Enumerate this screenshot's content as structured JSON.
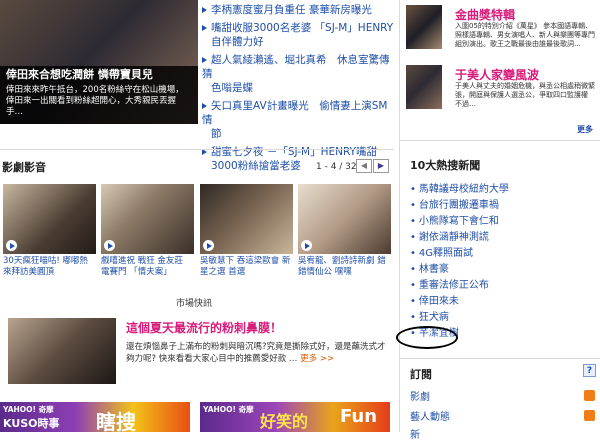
{
  "feature": {
    "title": "倖田來合想吃潤餅 憐帶寶貝兒",
    "desc": "倖田來來昨午抵台，200名粉絲守在松山機場，倖田來一出關看到粉絲超開心，大秀親民丟握手…"
  },
  "news": [
    "李柄憲度蜜月負重任 豪華新房曝光",
    "嘴甜收服3000名老婆 「SJ-M」HENRY",
    "自伴體力好",
    "超人氣綾瀨遙、堀北真希　休息室驚傳猜",
    "色嗡是蝶",
    "矢口真里AV計畫曝光　偷情妻上演SM情",
    "節",
    "甜蜜七夕夜 －「SJ-M」HENRY嘴甜",
    "3000粉絲搶當老婆"
  ],
  "media": {
    "title": "影劇影音",
    "pager": "1 - 4 / 32",
    "prev": "◀",
    "next": "▶",
    "videos": [
      {
        "caption": "30天瘋狂喵咕! 嘟嘟熱 來拜訪美圓頂"
      },
      {
        "caption": "戲嘻進祝 戰狂 金友莊 電賽門 「情夫案」"
      },
      {
        "caption": "吳敏慧下 吞這梁歐會 新星之選 首選"
      },
      {
        "caption": "吳宥龍、劉詩詩新劇 錯 錯情仙公 嘿嘿"
      }
    ]
  },
  "market": {
    "label": "市場快訊",
    "headline": "這個夏天最流行的粉刺鼻膜！",
    "body": "還在煩惱鼻子上滿布的粉刺與暗沉嗎?究竟是撕除式好，還是蘸洗式才夠力呢? 快來看看大家心目中的推薦愛好款 …",
    "more": "更多 >>"
  },
  "banners": [
    {
      "brand": "YAHOO! 奇摩",
      "text": "KUSO時事",
      "big": "瞎搜"
    },
    {
      "brand": "YAHOO! 奇摩",
      "text": "好笑的",
      "big": "Fun"
    }
  ],
  "sidebar": {
    "promos": [
      {
        "title": "金曲獎特輯",
        "desc": "入圍05的特別介紹《萬星》 參本國語專輯、照樣語專輯、男女演唱人、新人與樂團等專門組別演出。歌王之戰最後由誰最後歌詞…"
      },
      {
        "title": "于美人家變風波",
        "desc": "于美人與丈夫的婚姻危機，與丞公相處稍微緊張，開庭與保護人選丞公，爭取四口監護權 不過…"
      }
    ],
    "more": "更多",
    "hot_title": "10大熱搜新聞",
    "hot": [
      "馬韓議母校紐約大學",
      "台旅行團搬遷車禍",
      "小熊隊寫下會仁和",
      "謝依涵靜神測謊",
      "4G釋照面試",
      "林書豪",
      "重審法修正公布",
      "倖田來未",
      "狂犬病",
      "芊潔宜樹"
    ],
    "subscribe_title": "訂閱",
    "help": "?",
    "subscribe": [
      "影劇",
      "藝人動態",
      "新"
    ]
  }
}
